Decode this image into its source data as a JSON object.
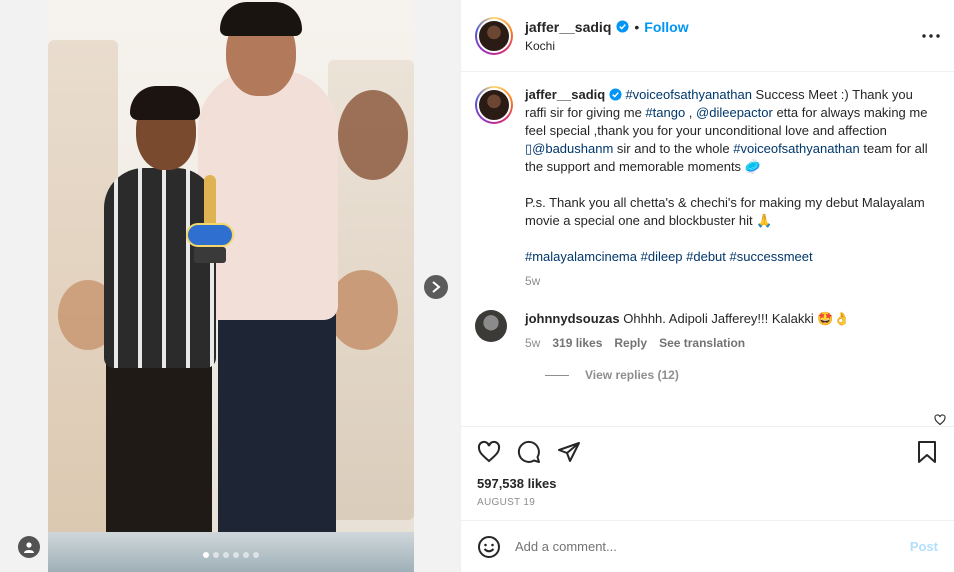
{
  "header": {
    "username": "jaffer__sadiq",
    "separator": "•",
    "follow_label": "Follow",
    "location": "Kochi"
  },
  "caption": {
    "username": "jaffer__sadiq",
    "segments": [
      {
        "t": "#voiceofsathyanathan",
        "tag": true
      },
      {
        "t": " Success Meet :) Thank you raffi sir for giving me ",
        "tag": false
      },
      {
        "t": "#tango",
        "tag": true
      },
      {
        "t": " , ",
        "tag": false
      },
      {
        "t": "@dileepactor",
        "tag": true
      },
      {
        "t": " etta for always making me feel special ,thank you for your unconditional love and affection ",
        "tag": false
      },
      {
        "t": "▯@badushanm",
        "tag": true
      },
      {
        "t": " sir and to the whole ",
        "tag": false
      },
      {
        "t": "#voiceofsathyanathan",
        "tag": true
      },
      {
        "t": " team for all the support and memorable moments 🥏",
        "tag": false
      }
    ],
    "ps": "P.s. Thank you all chetta's & chechi's for making my debut Malayalam movie a special one and blockbuster hit 🙏",
    "hashtags": "#malayalamcinema #dileep #debut #successmeet",
    "time": "5w"
  },
  "comment": {
    "username": "johnnydsouzas",
    "text": "Ohhhh. Adipoli Jafferey!!! Kalakki 🤩👌",
    "time": "5w",
    "likes": "319 likes",
    "reply_label": "Reply",
    "translate_label": "See translation",
    "view_replies": "View replies (12)"
  },
  "stats": {
    "likes": "597,538 likes",
    "date": "AUGUST 19"
  },
  "composer": {
    "placeholder": "Add a comment...",
    "post_label": "Post"
  },
  "colors": {
    "link_blue": "#0095f6",
    "tag_blue": "#00376b",
    "muted": "#8e8e8e",
    "post_disabled": "#b2dffc"
  },
  "icons": [
    "verified-badge-icon",
    "more-options-icon",
    "next-arrow-icon",
    "user-tag-icon",
    "heart-icon",
    "comment-icon",
    "share-icon",
    "bookmark-icon",
    "emoji-icon"
  ],
  "carousel": {
    "slides": 6,
    "active": 1
  }
}
